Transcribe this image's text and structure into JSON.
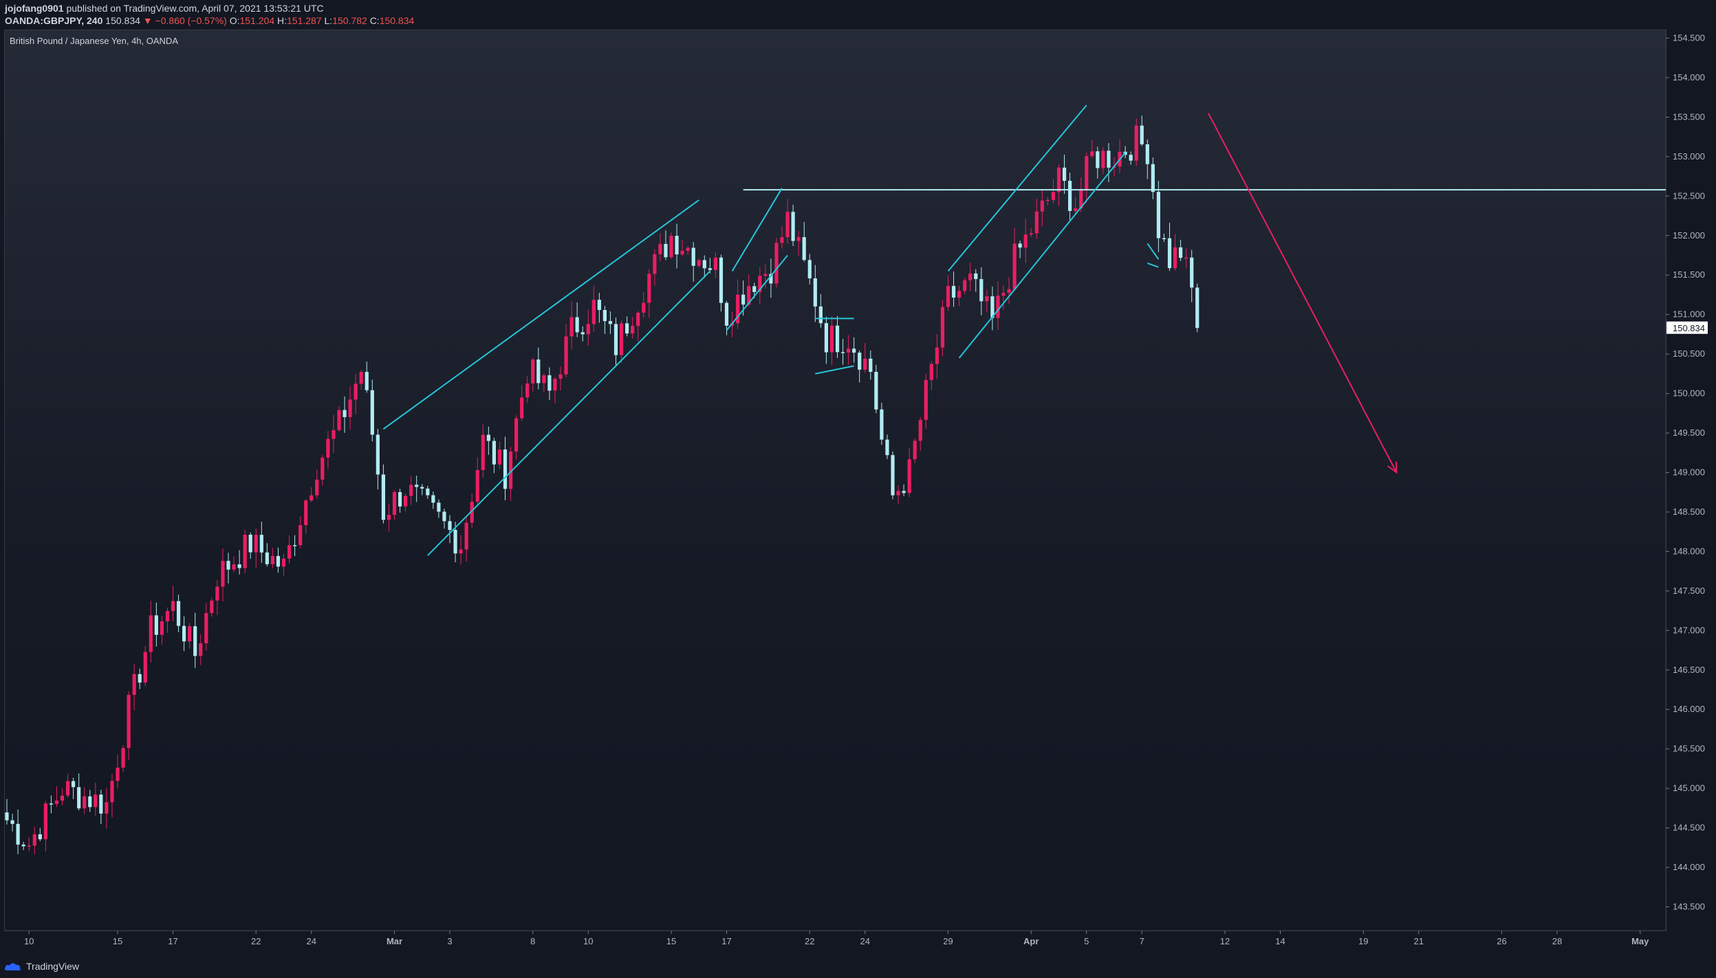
{
  "header": {
    "publisher": "jojofang0901",
    "published_text": "published on TradingView.com, April 07, 2021 13:53:21 UTC",
    "symbol": "OANDA:GBPJPY, 240",
    "last_price": "150.834",
    "change": "▼ −0.860 (−0.57%)",
    "open_label": "O:",
    "open_value": "151.204",
    "high_label": "H:",
    "high_value": "151.287",
    "low_label": "L:",
    "low_value": "150.782",
    "close_label": "C:",
    "close_value": "150.834"
  },
  "chart_title": "British Pound / Japanese Yen, 4h, OANDA",
  "footer": {
    "brand": "TradingView"
  },
  "colors": {
    "up": "#e91e63",
    "down": "#b2ebf2",
    "trendline": "#26c6da",
    "horizontal": "#b2ebf2",
    "arrow": "#e91e63"
  },
  "chart_data": {
    "type": "candlestick",
    "title": "British Pound / Japanese Yen, 4h, OANDA",
    "ylim": [
      143.2,
      154.6
    ],
    "y_ticks": [
      "143.500",
      "144.000",
      "144.500",
      "145.000",
      "145.500",
      "146.000",
      "146.500",
      "147.000",
      "147.500",
      "148.000",
      "148.500",
      "149.000",
      "149.500",
      "150.000",
      "150.500",
      "151.000",
      "151.500",
      "152.000",
      "152.500",
      "153.000",
      "153.500",
      "154.000",
      "154.500"
    ],
    "x_ticks": [
      {
        "label": "10",
        "bar": 4,
        "bold": false
      },
      {
        "label": "15",
        "bar": 20,
        "bold": false
      },
      {
        "label": "17",
        "bar": 30,
        "bold": false
      },
      {
        "label": "22",
        "bar": 45,
        "bold": false
      },
      {
        "label": "24",
        "bar": 55,
        "bold": false
      },
      {
        "label": "Mar",
        "bar": 70,
        "bold": true
      },
      {
        "label": "3",
        "bar": 80,
        "bold": false
      },
      {
        "label": "8",
        "bar": 95,
        "bold": false
      },
      {
        "label": "10",
        "bar": 105,
        "bold": false
      },
      {
        "label": "15",
        "bar": 120,
        "bold": false
      },
      {
        "label": "17",
        "bar": 130,
        "bold": false
      },
      {
        "label": "22",
        "bar": 145,
        "bold": false
      },
      {
        "label": "24",
        "bar": 155,
        "bold": false
      },
      {
        "label": "29",
        "bar": 170,
        "bold": false
      },
      {
        "label": "Apr",
        "bar": 185,
        "bold": true
      },
      {
        "label": "5",
        "bar": 195,
        "bold": false
      },
      {
        "label": "7",
        "bar": 205,
        "bold": false
      },
      {
        "label": "12",
        "bar": 220,
        "bold": false
      },
      {
        "label": "14",
        "bar": 230,
        "bold": false
      },
      {
        "label": "19",
        "bar": 245,
        "bold": false
      },
      {
        "label": "21",
        "bar": 255,
        "bold": false
      },
      {
        "label": "26",
        "bar": 270,
        "bold": false
      },
      {
        "label": "28",
        "bar": 280,
        "bold": false
      },
      {
        "label": "May",
        "bar": 295,
        "bold": true
      }
    ],
    "key_prices": [
      {
        "bar": 0,
        "price": 144.6
      },
      {
        "bar": 4,
        "price": 144.3
      },
      {
        "bar": 10,
        "price": 145.0
      },
      {
        "bar": 18,
        "price": 144.8
      },
      {
        "bar": 22,
        "price": 146.0
      },
      {
        "bar": 26,
        "price": 147.0
      },
      {
        "bar": 30,
        "price": 147.3
      },
      {
        "bar": 34,
        "price": 146.7
      },
      {
        "bar": 38,
        "price": 147.7
      },
      {
        "bar": 44,
        "price": 148.1
      },
      {
        "bar": 50,
        "price": 147.8
      },
      {
        "bar": 56,
        "price": 149.1
      },
      {
        "bar": 60,
        "price": 149.6
      },
      {
        "bar": 64,
        "price": 150.3
      },
      {
        "bar": 66,
        "price": 149.5
      },
      {
        "bar": 68,
        "price": 148.5
      },
      {
        "bar": 72,
        "price": 148.8
      },
      {
        "bar": 78,
        "price": 148.4
      },
      {
        "bar": 82,
        "price": 148.1
      },
      {
        "bar": 86,
        "price": 149.4
      },
      {
        "bar": 90,
        "price": 149.0
      },
      {
        "bar": 94,
        "price": 150.3
      },
      {
        "bar": 98,
        "price": 150.0
      },
      {
        "bar": 102,
        "price": 150.8
      },
      {
        "bar": 106,
        "price": 151.1
      },
      {
        "bar": 110,
        "price": 150.6
      },
      {
        "bar": 116,
        "price": 151.5
      },
      {
        "bar": 120,
        "price": 152.0
      },
      {
        "bar": 124,
        "price": 151.8
      },
      {
        "bar": 128,
        "price": 151.6
      },
      {
        "bar": 130,
        "price": 151.0
      },
      {
        "bar": 134,
        "price": 151.4
      },
      {
        "bar": 138,
        "price": 151.6
      },
      {
        "bar": 141,
        "price": 152.2
      },
      {
        "bar": 144,
        "price": 151.6
      },
      {
        "bar": 146,
        "price": 151.2
      },
      {
        "bar": 148,
        "price": 150.7
      },
      {
        "bar": 152,
        "price": 150.7
      },
      {
        "bar": 156,
        "price": 150.3
      },
      {
        "bar": 158,
        "price": 149.4
      },
      {
        "bar": 160,
        "price": 148.7
      },
      {
        "bar": 163,
        "price": 149.0
      },
      {
        "bar": 166,
        "price": 150.0
      },
      {
        "bar": 170,
        "price": 151.2
      },
      {
        "bar": 174,
        "price": 151.4
      },
      {
        "bar": 178,
        "price": 150.9
      },
      {
        "bar": 182,
        "price": 151.7
      },
      {
        "bar": 186,
        "price": 152.2
      },
      {
        "bar": 190,
        "price": 152.7
      },
      {
        "bar": 193,
        "price": 152.4
      },
      {
        "bar": 196,
        "price": 153.0
      },
      {
        "bar": 200,
        "price": 153.0
      },
      {
        "bar": 204,
        "price": 153.2
      },
      {
        "bar": 206,
        "price": 153.1
      },
      {
        "bar": 208,
        "price": 152.1
      },
      {
        "bar": 210,
        "price": 151.7
      },
      {
        "bar": 212,
        "price": 151.8
      },
      {
        "bar": 214,
        "price": 151.3
      },
      {
        "bar": 215,
        "price": 150.83
      }
    ],
    "last_price_label": "150.834",
    "annotations": [
      {
        "type": "horizontal_line",
        "price": 152.58,
        "from_bar": 133
      },
      {
        "type": "trendline",
        "points": [
          [
            68,
            149.55
          ],
          [
            125,
            152.45
          ]
        ]
      },
      {
        "type": "trendline",
        "points": [
          [
            76,
            147.95
          ],
          [
            127,
            151.55
          ]
        ]
      },
      {
        "type": "trendline",
        "points": [
          [
            131,
            151.55
          ],
          [
            140,
            152.6
          ]
        ]
      },
      {
        "type": "trendline",
        "points": [
          [
            130,
            150.8
          ],
          [
            141,
            151.75
          ]
        ]
      },
      {
        "type": "trendline",
        "points": [
          [
            146,
            150.95
          ],
          [
            153,
            150.95
          ]
        ]
      },
      {
        "type": "trendline",
        "points": [
          [
            146,
            150.25
          ],
          [
            153,
            150.35
          ]
        ]
      },
      {
        "type": "trendline",
        "points": [
          [
            170,
            151.55
          ],
          [
            195,
            153.65
          ]
        ]
      },
      {
        "type": "trendline",
        "points": [
          [
            172,
            150.45
          ],
          [
            202,
            153.05
          ]
        ]
      },
      {
        "type": "trendline",
        "points": [
          [
            206,
            151.9
          ],
          [
            208,
            151.7
          ]
        ]
      },
      {
        "type": "trendline",
        "points": [
          [
            206,
            151.65
          ],
          [
            208,
            151.6
          ]
        ]
      },
      {
        "type": "arrow",
        "points": [
          [
            217,
            153.55
          ],
          [
            251,
            149.0
          ]
        ]
      }
    ]
  }
}
